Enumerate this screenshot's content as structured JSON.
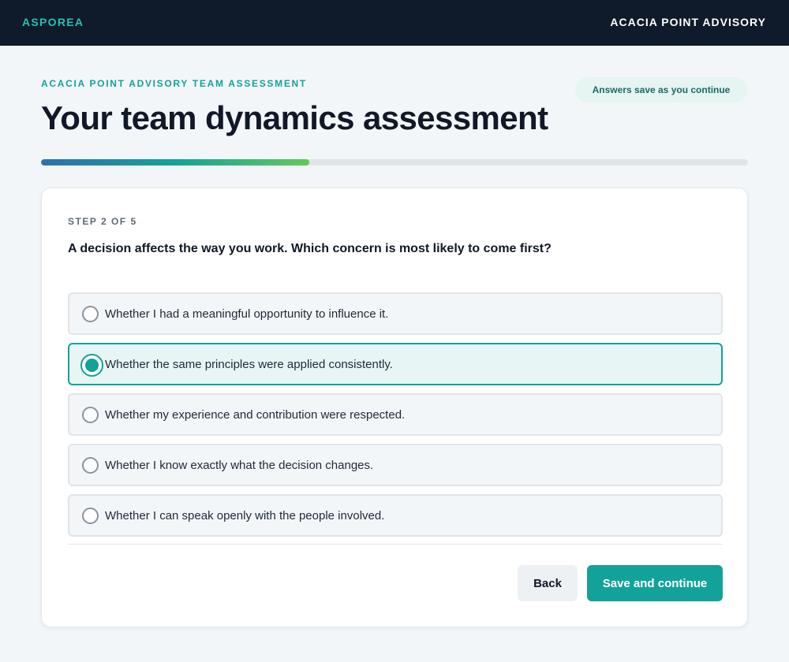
{
  "header": {
    "brand": "ASPOREA",
    "org_name": "ACACIA POINT ADVISORY"
  },
  "page": {
    "eyebrow": "ACACIA POINT ADVISORY TEAM ASSESSMENT",
    "title": "Your team dynamics assessment",
    "save_status": "Answers save as you continue",
    "progress_fraction": 0.38
  },
  "question_card": {
    "step_label": "STEP 2 OF 5",
    "question": "A decision affects the way you work. Which concern is most likely to come first?",
    "selected_index": 1,
    "options": [
      {
        "label": "Whether I had a meaningful opportunity to influence it."
      },
      {
        "label": "Whether the same principles were applied consistently."
      },
      {
        "label": "Whether my experience and contribution were respected."
      },
      {
        "label": "Whether I know exactly what the decision changes."
      },
      {
        "label": "Whether I can speak openly with the people involved."
      }
    ]
  },
  "actions": {
    "back_label": "Back",
    "save_label": "Save and continue"
  },
  "colors": {
    "accent": "#13a299",
    "topbar": "#0f1a2a",
    "brand": "#2bbfb0"
  }
}
